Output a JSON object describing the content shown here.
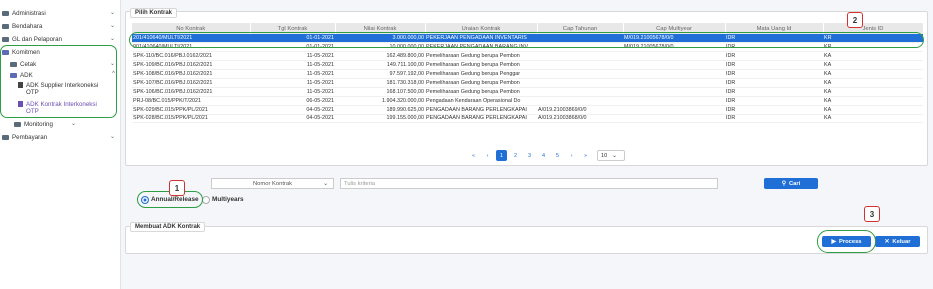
{
  "sidebar": {
    "items": [
      {
        "label": "Administrasi",
        "chev": "⌄"
      },
      {
        "label": "Bendahara",
        "chev": "⌄"
      },
      {
        "label": "GL dan Pelaporan",
        "chev": "⌄"
      },
      {
        "label": "Komitmen",
        "chev": ""
      },
      {
        "label": "Cetak",
        "chev": "⌄"
      },
      {
        "label": "ADK",
        "chev": "^"
      },
      {
        "label": "ADK Supplier Interkoneksi OTP",
        "chev": ""
      },
      {
        "label": "ADK Kontrak Interkoneksi OTP",
        "chev": ""
      },
      {
        "label": "Monitoring",
        "chev": "⌄"
      },
      {
        "label": "Pembayaran",
        "chev": "⌄"
      }
    ]
  },
  "pilih": {
    "title": "Pilih Kontrak",
    "columns": [
      "No Kontrak",
      "Tgl Kontrak",
      "Nilai Kontrak",
      "Uraian Kontrak",
      "Cap Tahunan",
      "Cap Multiyear",
      "Mata Uang Id",
      "Jenis ID"
    ],
    "rows": [
      [
        "201/410640/MULTI/2021",
        "01-01-2021",
        "3.000.000,00",
        "PEKERJAAN PENGADAAN INVENTARIS",
        "",
        "M/019.21005678/0/0",
        "IDR",
        "KR"
      ],
      [
        "001/410640/MULTI/2021",
        "01-01-2021",
        "10.000.000,00",
        "PEKERJAAN PENGADAAN BARANG INV",
        "",
        "M/019.21005678/0/0",
        "IDR",
        "KR"
      ],
      [
        "SPK-110/BC.016/PBJ.0162/2021",
        "11-05-2021",
        "162.489.800,00",
        "Pemeliharaan Gedung berupa Pembon",
        "",
        "",
        "IDR",
        "KA"
      ],
      [
        "SPK-109/BC.016/PBJ.0162/2021",
        "11-05-2021",
        "149.711.100,00",
        "Pemeliharaan Gedung berupa Pembon",
        "",
        "",
        "IDR",
        "KA"
      ],
      [
        "SPK-108/BC.016/PBJ.0162/2021",
        "11-05-2021",
        "97.597.192,00",
        "Pemeliharaan Gedung berupa Penggar",
        "",
        "",
        "IDR",
        "KA"
      ],
      [
        "SPK-107/BC.016/PBJ.0162/2021",
        "11-05-2021",
        "181.730.318,00",
        "Pemeliharaan Gedung berupa Pembon",
        "",
        "",
        "IDR",
        "KA"
      ],
      [
        "SPK-106/BC.016/PBJ.0162/2021",
        "11-05-2021",
        "168.107.500,00",
        "Pemeliharaan Gedung berupa Pembon",
        "",
        "",
        "IDR",
        "KA"
      ],
      [
        "PRJ-08/BC.015/PPK/T/2021",
        "06-05-2021",
        "1.904.320.000,00",
        "Pengadaan Kendaraan Operasional Do",
        "",
        "",
        "IDR",
        "KA"
      ],
      [
        "SPK-029/BC.015/PPK/PL/2021",
        "04-05-2021",
        "189.990.625,00",
        "PENGADAAN BARANG PERLENGKAPAI",
        "A/019.21003869/0/0",
        "",
        "IDR",
        "KA"
      ],
      [
        "SPK-028/BC.015/PPK/PL/2021",
        "04-05-2021",
        "199.155.000,00",
        "PENGADAAN BARANG PERLENGKAPAI",
        "A/019.21003868/0/0",
        "",
        "IDR",
        "KA"
      ]
    ]
  },
  "pager": {
    "first": "«",
    "prev": "‹",
    "pages": [
      "1",
      "2",
      "3",
      "4",
      "5"
    ],
    "next": "›",
    "last": "»",
    "size": "10"
  },
  "search": {
    "select": "Nomor Kontrak",
    "placeholder": "Tulis kriteria",
    "button": "Cari"
  },
  "radios": {
    "annual": "Annual/Release",
    "multi": "Multiyears"
  },
  "buat": {
    "title": "Membuat ADK Kontrak",
    "process": "Process",
    "keluar": "Keluar"
  },
  "callouts": [
    "1",
    "2",
    "3"
  ]
}
